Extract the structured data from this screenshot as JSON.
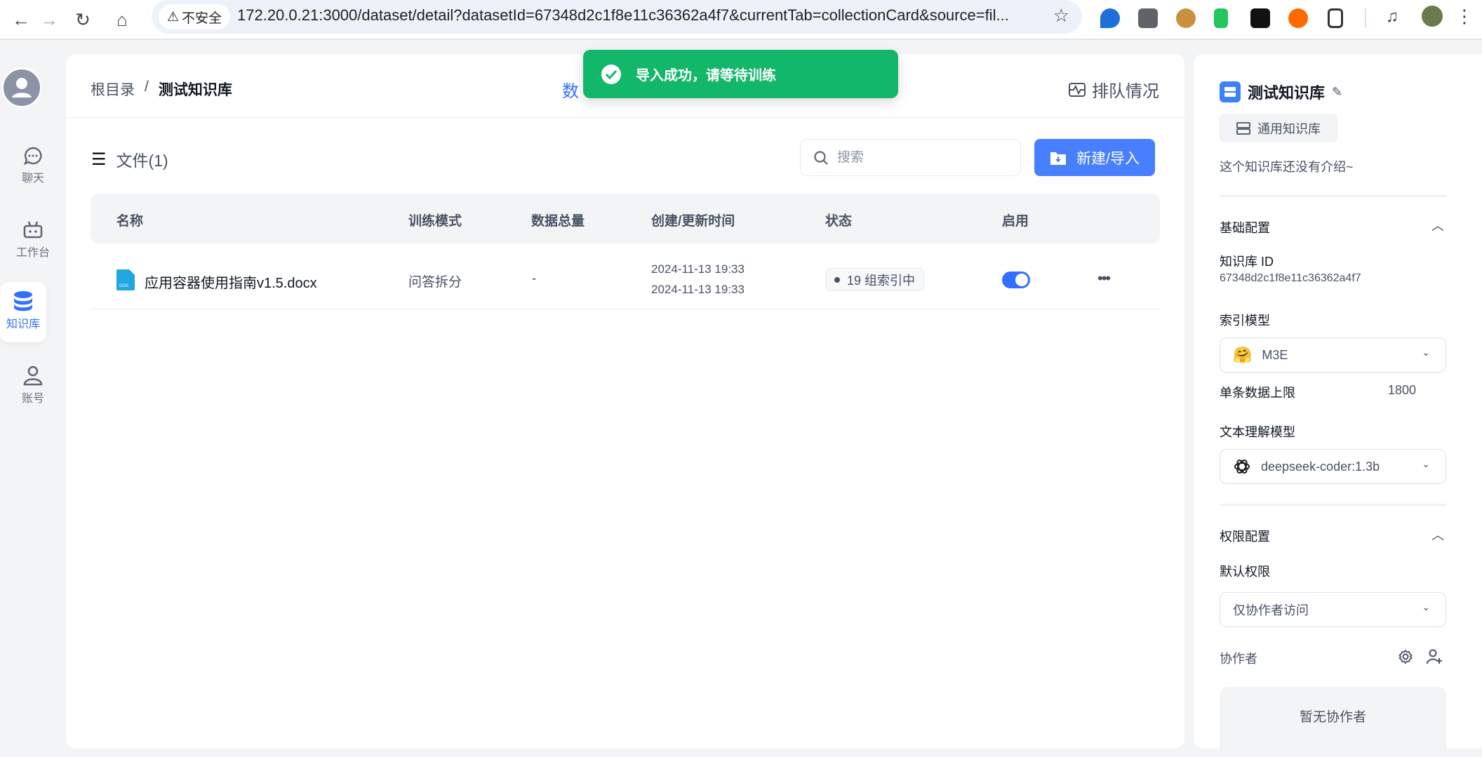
{
  "browser": {
    "insecure_label": "不安全",
    "url": "172.20.0.21:3000/dataset/detail?datasetId=67348d2c1f8e11c36362a4f7&currentTab=collectionCard&source=fil..."
  },
  "sidebar": {
    "items": [
      {
        "label": "聊天"
      },
      {
        "label": "工作台"
      },
      {
        "label": "知识库"
      },
      {
        "label": "账号"
      }
    ]
  },
  "header": {
    "breadcrumb_root": "根目录",
    "breadcrumb_sep": "/",
    "breadcrumb_current": "测试知识库",
    "tab_partial": "数",
    "queue_label": "排队情况"
  },
  "toast": {
    "message": "导入成功，请等待训练"
  },
  "files": {
    "title": "文件(1)",
    "search_placeholder": "搜索",
    "new_button": "新建/导入",
    "columns": [
      "名称",
      "训练模式",
      "数据总量",
      "创建/更新时间",
      "状态",
      "启用"
    ],
    "rows": [
      {
        "name": "应用容器使用指南v1.5.docx",
        "mode": "问答拆分",
        "count": "-",
        "created": "2024-11-13 19:33",
        "updated": "2024-11-13 19:33",
        "status": "19 组索引中",
        "enabled": true
      }
    ]
  },
  "panel": {
    "title": "测试知识库",
    "type_tag": "通用知识库",
    "intro": "这个知识库还没有介绍~",
    "basic_section": "基础配置",
    "id_label": "知识库 ID",
    "id_value": "67348d2c1f8e11c36362a4f7",
    "index_model_label": "索引模型",
    "index_model": "M3E",
    "max_label": "单条数据上限",
    "max_value": "1800",
    "text_model_label": "文本理解模型",
    "text_model": "deepseek-coder:1.3b",
    "perm_section": "权限配置",
    "default_perm_label": "默认权限",
    "default_perm": "仅协作者访问",
    "collab_label": "协作者",
    "no_collab": "暂无协作者"
  },
  "colors": {
    "accent": "#487fff",
    "toast": "#13b76a"
  }
}
